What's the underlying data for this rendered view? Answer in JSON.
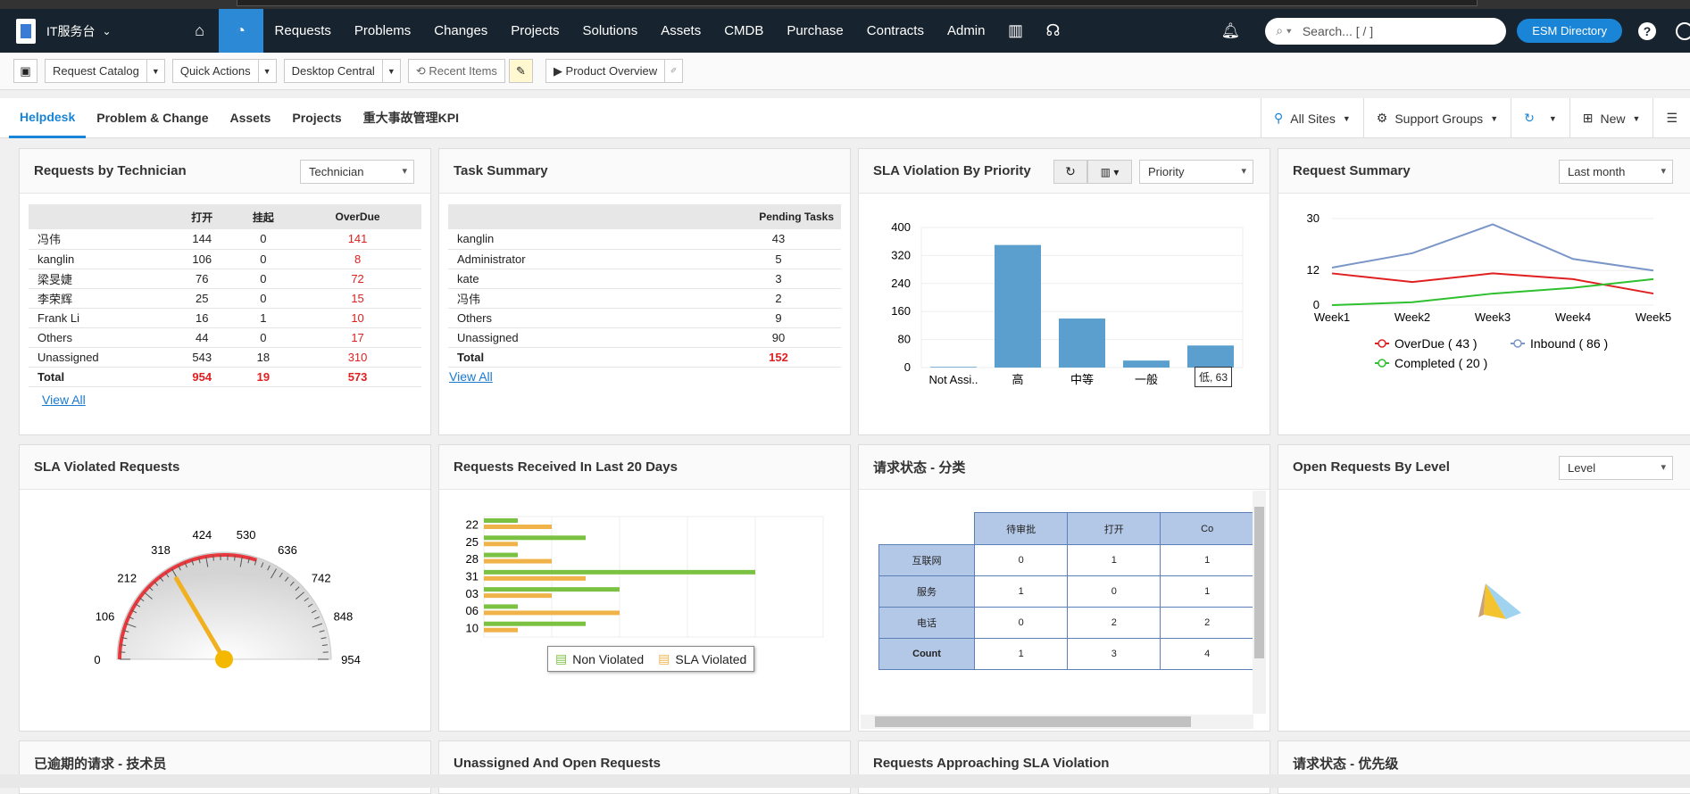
{
  "nav": {
    "app_name": "IT服务台",
    "items": [
      "Requests",
      "Problems",
      "Changes",
      "Projects",
      "Solutions",
      "Assets",
      "CMDB",
      "Purchase",
      "Contracts",
      "Admin"
    ],
    "search_placeholder": "Search... [ / ]",
    "esm_label": "ESM Directory",
    "help": "?"
  },
  "toolbar": {
    "request_catalog": "Request Catalog",
    "quick_actions": "Quick Actions",
    "desktop_central": "Desktop Central",
    "recent_items": "Recent Items",
    "product_overview": "Product Overview"
  },
  "tabs": {
    "items": [
      "Helpdesk",
      "Problem & Change",
      "Assets",
      "Projects",
      "重大事故管理KPI"
    ],
    "all_sites": "All Sites",
    "support_groups": "Support Groups",
    "new": "New"
  },
  "requests_by_tech": {
    "title": "Requests by Technician",
    "select": "Technician",
    "headers": [
      "打开",
      "挂起",
      "OverDue"
    ],
    "rows": [
      {
        "name": "冯伟",
        "open": "144",
        "hold": "0",
        "overdue": "141"
      },
      {
        "name": "kanglin",
        "open": "106",
        "hold": "0",
        "overdue": "8"
      },
      {
        "name": "梁旻婕",
        "open": "76",
        "hold": "0",
        "overdue": "72"
      },
      {
        "name": "李荣辉",
        "open": "25",
        "hold": "0",
        "overdue": "15"
      },
      {
        "name": "Frank Li",
        "open": "16",
        "hold": "1",
        "overdue": "10"
      },
      {
        "name": "Others",
        "open": "44",
        "hold": "0",
        "overdue": "17"
      },
      {
        "name": "Unassigned",
        "open": "543",
        "hold": "18",
        "overdue": "310"
      },
      {
        "name": "Total",
        "open": "954",
        "hold": "19",
        "overdue": "573"
      }
    ],
    "view_all": "View All"
  },
  "task_summary": {
    "title": "Task Summary",
    "header": "Pending Tasks",
    "rows": [
      {
        "name": "kanglin",
        "value": "43"
      },
      {
        "name": "Administrator",
        "value": "5"
      },
      {
        "name": "kate",
        "value": "3"
      },
      {
        "name": "冯伟",
        "value": "2"
      },
      {
        "name": "Others",
        "value": "9"
      },
      {
        "name": "Unassigned",
        "value": "90"
      },
      {
        "name": "Total",
        "value": "152"
      }
    ],
    "view_all": "View All"
  },
  "sla_priority": {
    "title": "SLA Violation By Priority",
    "select": "Priority",
    "tooltip": "低, 63"
  },
  "request_summary": {
    "title": "Request Summary",
    "select": "Last month"
  },
  "sla_violated": {
    "title": "SLA Violated Requests"
  },
  "received_20": {
    "title": "Requests Received In Last 20 Days"
  },
  "status_category": {
    "title": "请求状态 - 分类",
    "cols": [
      "待审批",
      "打开",
      "Co"
    ],
    "rows": [
      {
        "label": "互联网",
        "v": [
          "0",
          "1",
          "1"
        ]
      },
      {
        "label": "服务",
        "v": [
          "1",
          "0",
          "1"
        ]
      },
      {
        "label": "电话",
        "v": [
          "0",
          "2",
          "2"
        ]
      },
      {
        "label": "Count",
        "v": [
          "1",
          "3",
          "4"
        ]
      }
    ]
  },
  "open_by_level": {
    "title": "Open Requests By Level",
    "select": "Level"
  },
  "bottom_titles": [
    "已逾期的请求 - 技术员",
    "Unassigned And Open Requests",
    "Requests Approaching SLA Violation",
    "请求状态 - 优先级"
  ],
  "chart_data": [
    {
      "type": "bar",
      "title": "SLA Violation By Priority",
      "categories": [
        "Not Assi..",
        "高",
        "中等",
        "一般",
        "低"
      ],
      "values": [
        2,
        350,
        140,
        20,
        63
      ],
      "ylim": [
        0,
        400
      ],
      "yticks": [
        "0",
        "80",
        "160",
        "240",
        "320",
        "400"
      ],
      "color": "#5a9fcd"
    },
    {
      "type": "line",
      "title": "Request Summary",
      "categories": [
        "Week1",
        "Week2",
        "Week3",
        "Week4",
        "Week5"
      ],
      "ylim": [
        0,
        30
      ],
      "yticks": [
        "0",
        "12",
        "30"
      ],
      "series": [
        {
          "name": "OverDue ( 43 )",
          "color": "#e02020",
          "values": [
            11,
            8,
            11,
            9,
            4
          ]
        },
        {
          "name": "Inbound ( 86 )",
          "color": "#7a96c8",
          "values": [
            13,
            18,
            28,
            16,
            12
          ]
        },
        {
          "name": "Completed ( 20 )",
          "color": "#2ec02e",
          "values": [
            0,
            1,
            4,
            6,
            9
          ]
        }
      ]
    },
    {
      "type": "gauge",
      "title": "SLA Violated Requests",
      "min": 0,
      "max": 954,
      "value": 573,
      "ticks": [
        "0",
        "106",
        "212",
        "318",
        "424",
        "530",
        "636",
        "742",
        "848",
        "954"
      ]
    },
    {
      "type": "bar",
      "title": "Requests Received In Last 20 Days",
      "orientation": "horizontal",
      "categories": [
        "22",
        "25",
        "28",
        "31",
        "03",
        "06",
        "10"
      ],
      "series": [
        {
          "name": "Non Violated",
          "color": "#7cc242",
          "values": [
            1,
            3,
            1,
            8,
            4,
            1,
            3
          ]
        },
        {
          "name": "SLA Violated",
          "color": "#f0b34a",
          "values": [
            2,
            1,
            2,
            3,
            2,
            4,
            1
          ]
        }
      ]
    }
  ]
}
